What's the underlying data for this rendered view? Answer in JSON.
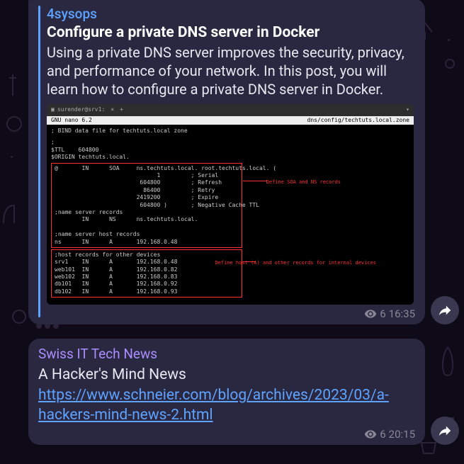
{
  "msg1": {
    "source": "4sysops",
    "title": "Configure a private DNS server in Docker",
    "desc": "Using a private DNS server improves the security, privacy, and performance of your network. In this post, you will learn how to configure a private DNS server in Docker.",
    "views": "6",
    "time": "16:35",
    "term": {
      "tab_user": "surender@srv1:",
      "hdr_left": "GNU nano 6.2",
      "hdr_right": "dns/config/techtuts.local.zone",
      "comment": "; BIND data file for techtuts.local zone",
      "ttl": "$TTL    604800",
      "origin": "$ORIGIN techtuts.local.",
      "box1": "@       IN      SOA     ns.techtuts.local. root.techtuts.local. (\n                              1         ; Serial\n                         604800         ; Refresh\n                          86400         ; Retry\n                        2419200         ; Expire\n                         604800 )       ; Negative Cache TTL\n;name server records\n        IN      NS      ns.techtuts.local.\n\n;name server host records\nns      IN      A       192.168.0.48",
      "label1": "Define SOA and NS records",
      "box2": ";host records for other devices\nsrv1    IN      A       192.168.0.48\nweb101  IN      A       192.168.0.82\nweb102  IN      A       192.168.0.83\ndb101   IN      A       192.168.0.92\ndb102   IN      A       192.168.0.93",
      "label2": "Define host (A) and other records for internal devices"
    }
  },
  "msg2": {
    "source": "Swiss IT Tech News",
    "body_prefix": "A Hacker's Mind News   ",
    "link": "https://www.schneier.com/blog/archives/2023/03/a-hackers-mind-news-2.html",
    "views": "6",
    "time": "20:15"
  }
}
